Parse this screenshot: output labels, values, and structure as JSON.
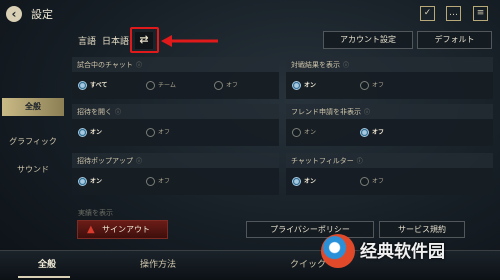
{
  "header": {
    "title": "設定",
    "icons": [
      "mission-icon",
      "chat-icon",
      "menu-icon"
    ]
  },
  "sidebar": {
    "items": [
      {
        "label": "全般"
      },
      {
        "label": "グラフィック"
      },
      {
        "label": "サウンド"
      }
    ]
  },
  "language": {
    "label": "言語",
    "value": "日本語"
  },
  "buttons": {
    "account_settings": "アカウント設定",
    "default": "デフォルト",
    "sign_out": "サインアウト",
    "privacy": "プライバシーポリシー",
    "service": "サービス規約"
  },
  "panels": [
    {
      "title": "試合中のチャット",
      "options": [
        "すべて",
        "チーム",
        "オフ"
      ],
      "selected": 0
    },
    {
      "title": "対戦結果を表示",
      "options": [
        "オン",
        "オフ"
      ],
      "selected": 0
    },
    {
      "title": "招待を開く",
      "options": [
        "オン",
        "オフ"
      ],
      "selected": 0
    },
    {
      "title": "フレンド申請を非表示",
      "options": [
        "オン",
        "オフ"
      ],
      "selected": 1
    },
    {
      "title": "招待ポップアップ",
      "options": [
        "オン",
        "オフ"
      ],
      "selected": 0
    },
    {
      "title": "チャットフィルター",
      "options": [
        "オン",
        "オフ"
      ],
      "selected": 0
    }
  ],
  "faded_item": "実績を表示",
  "bottom_tabs": [
    {
      "label": "全般"
    },
    {
      "label": "操作方法"
    },
    {
      "label": "クイック"
    }
  ],
  "watermark": "经典软件园",
  "colors": {
    "accent_gold": "#d8cfb4",
    "selected_radio": "#a6c9e0",
    "signout_red": "#6b1c17",
    "annotation_red": "#e01a1a"
  }
}
